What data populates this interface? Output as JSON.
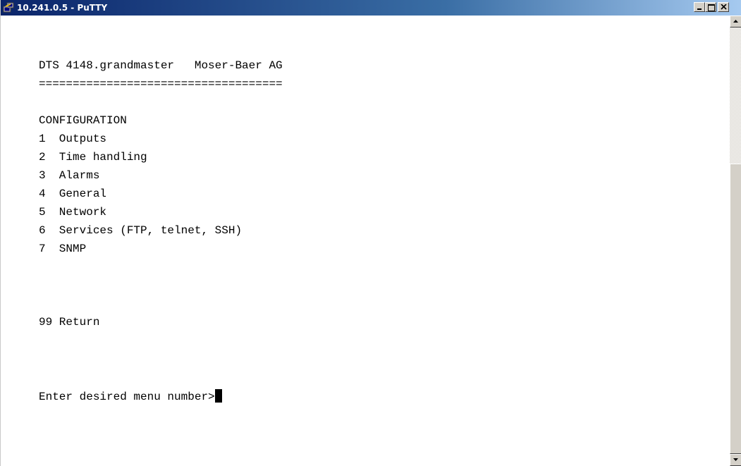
{
  "window": {
    "title": "10.241.0.5 - PuTTY",
    "icon": "putty-icon"
  },
  "terminal": {
    "lines": [
      "DTS 4148.grandmaster   Moser-Baer AG",
      "====================================",
      "",
      "CONFIGURATION",
      "1  Outputs",
      "2  Time handling",
      "3  Alarms",
      "4  General",
      "5  Network",
      "6  Services (FTP, telnet, SSH)",
      "7  SNMP",
      "",
      "",
      "",
      "99 Return",
      "",
      "",
      "",
      "Enter desired menu number>"
    ],
    "menu_items": [
      {
        "number": "1",
        "label": "Outputs"
      },
      {
        "number": "2",
        "label": "Time handling"
      },
      {
        "number": "3",
        "label": "Alarms"
      },
      {
        "number": "4",
        "label": "General"
      },
      {
        "number": "5",
        "label": "Network"
      },
      {
        "number": "6",
        "label": "Services (FTP, telnet, SSH)"
      },
      {
        "number": "7",
        "label": "SNMP"
      },
      {
        "number": "99",
        "label": "Return"
      }
    ],
    "prompt": "Enter desired menu number>"
  },
  "colors": {
    "terminal_bg": "#ffffff",
    "terminal_fg": "#000000",
    "titlebar_start": "#0a246a",
    "titlebar_end": "#a6caf0"
  }
}
